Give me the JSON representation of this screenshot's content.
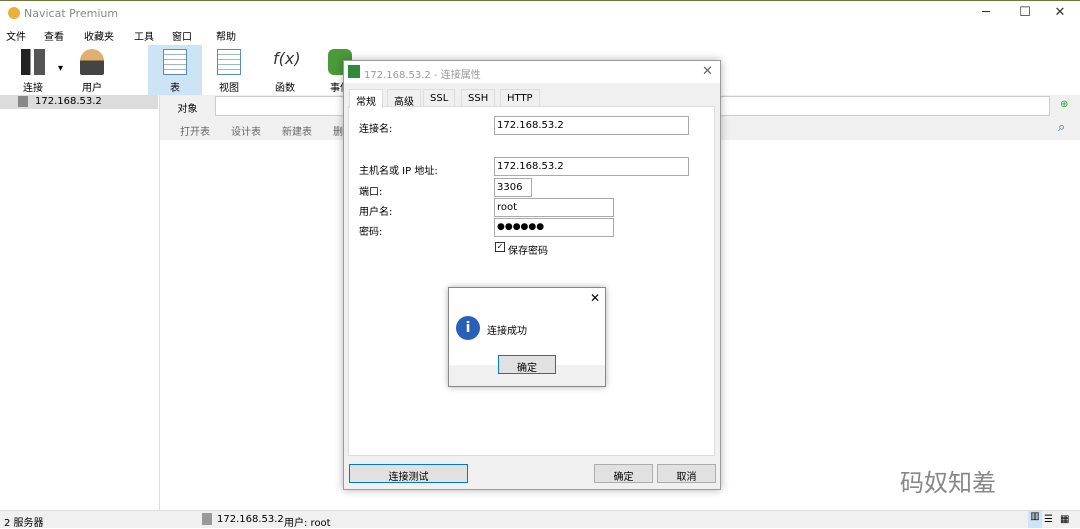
{
  "app": {
    "title": "Navicat Premium"
  },
  "menu": [
    "文件",
    "查看",
    "收藏夹",
    "工具",
    "窗口",
    "帮助"
  ],
  "toolbar": [
    {
      "label": "连接",
      "icon": "plug-icon"
    },
    {
      "label": "用户",
      "icon": "user-icon"
    },
    {
      "label": "表",
      "icon": "table-icon",
      "selected": true
    },
    {
      "label": "视图",
      "icon": "view-icon"
    },
    {
      "label": "函数",
      "icon": "function-icon"
    },
    {
      "label": "事件",
      "icon": "event-icon"
    }
  ],
  "tree": {
    "items": [
      "172.168.53.2"
    ]
  },
  "main": {
    "object_tab": "对象",
    "actions": [
      "打开表",
      "设计表",
      "新建表",
      "删除表"
    ]
  },
  "status": {
    "servers": "2 服务器",
    "connection": "172.168.53.2",
    "user": "用户: root"
  },
  "dialog": {
    "title": "172.168.53.2 - 连接属性",
    "tabs": [
      "常规",
      "高级",
      "SSL",
      "SSH",
      "HTTP"
    ],
    "fields": {
      "conn_name_label": "连接名:",
      "conn_name": "172.168.53.2",
      "host_label": "主机名或 IP 地址:",
      "host": "172.168.53.2",
      "port_label": "端口:",
      "port": "3306",
      "user_label": "用户名:",
      "user": "root",
      "pwd_label": "密码:",
      "pwd": "●●●●●●",
      "save_pwd": "保存密码",
      "save_pwd_checked": true
    },
    "test_btn": "连接测试",
    "ok_btn": "确定",
    "cancel_btn": "取消"
  },
  "msgbox": {
    "text": "连接成功",
    "ok": "确定",
    "icon": "info-icon"
  },
  "watermark": "码奴知羞",
  "colors": {
    "accent": "#0078d7",
    "selected": "#cde4f7"
  }
}
